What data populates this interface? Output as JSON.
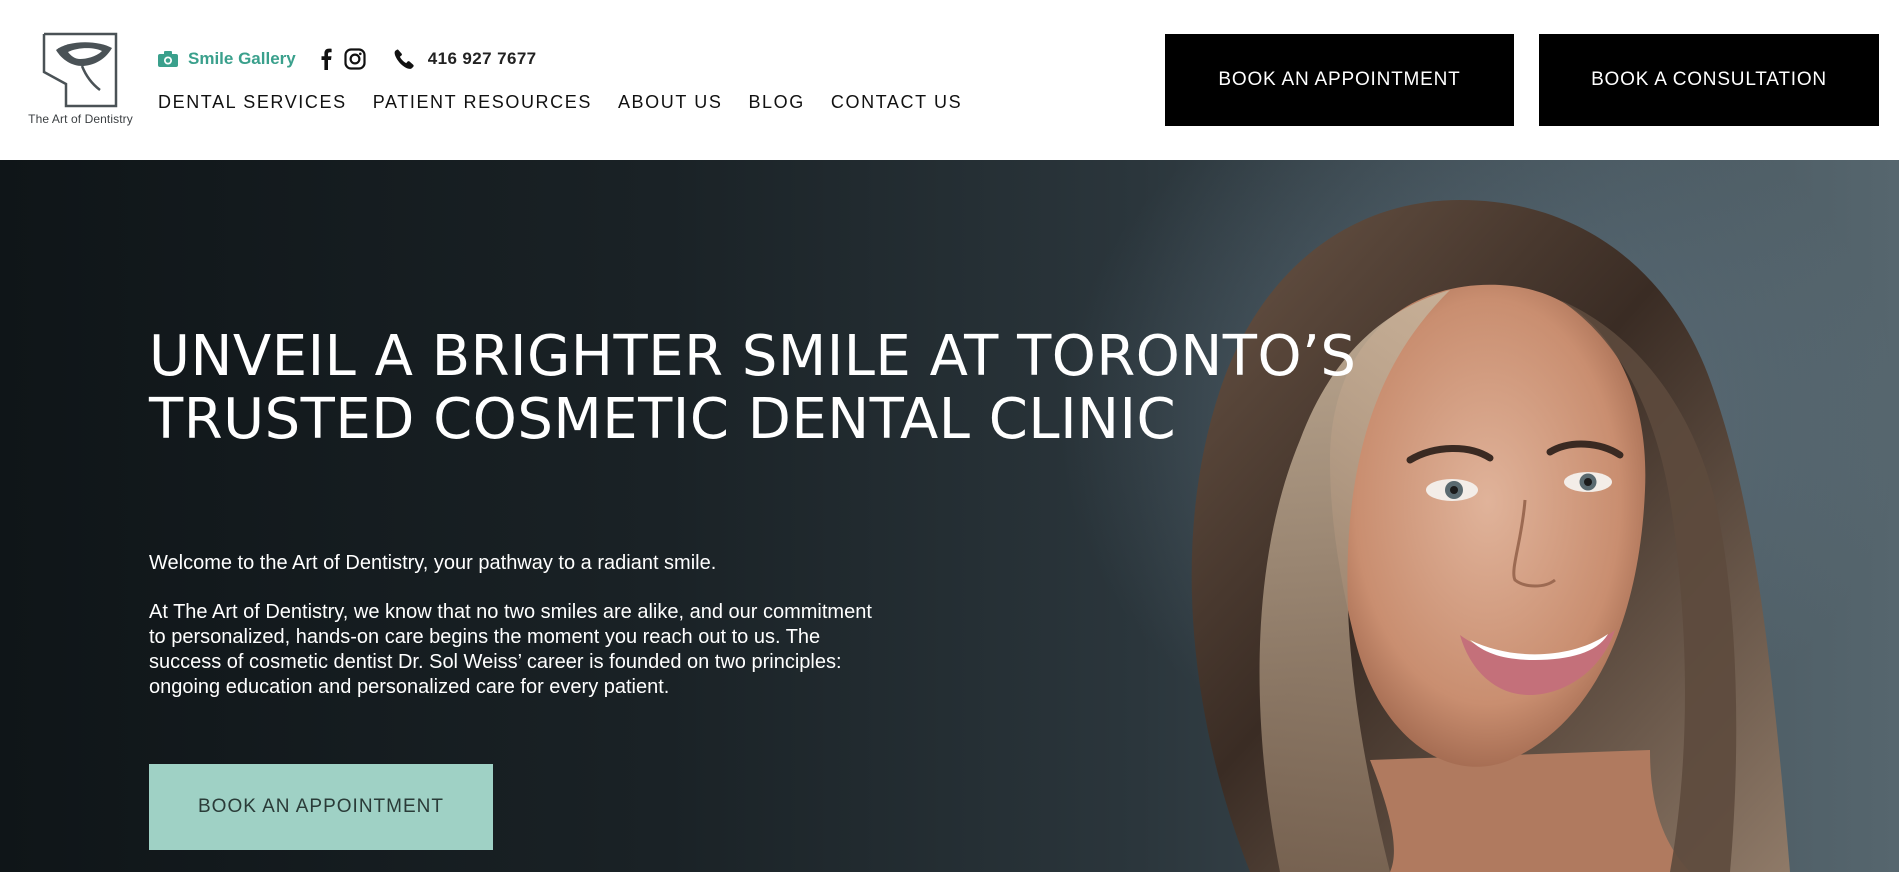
{
  "brand": {
    "logo_text": "The Art of Dentistry"
  },
  "topbar": {
    "gallery_label": "Smile Gallery",
    "phone": "416 927 7677",
    "accent_color": "#3aa08c"
  },
  "nav": {
    "items": [
      {
        "label": "DENTAL SERVICES"
      },
      {
        "label": "PATIENT RESOURCES"
      },
      {
        "label": "ABOUT US"
      },
      {
        "label": "BLOG"
      },
      {
        "label": "CONTACT US"
      }
    ]
  },
  "header_buttons": {
    "appointment": "BOOK AN APPOINTMENT",
    "consultation": "BOOK A CONSULTATION"
  },
  "hero": {
    "title": "UNVEIL A BRIGHTER SMILE AT TORONTO’S TRUSTED COSMETIC DENTAL CLINIC",
    "intro": "Welcome to the Art of Dentistry, your pathway to a radiant smile.",
    "body": "At The Art of Dentistry, we know that no two smiles are alike, and our commitment to personalized, hands-on care begins the moment you reach out to us. The success of cosmetic dentist Dr. Sol Weiss’ career is founded on two principles: ongoing education and personalized care for every patient.",
    "cta": "BOOK AN APPOINTMENT",
    "cta_color": "#9fd1c5"
  },
  "icons": [
    "camera-icon",
    "facebook-icon",
    "instagram-icon",
    "phone-icon"
  ]
}
